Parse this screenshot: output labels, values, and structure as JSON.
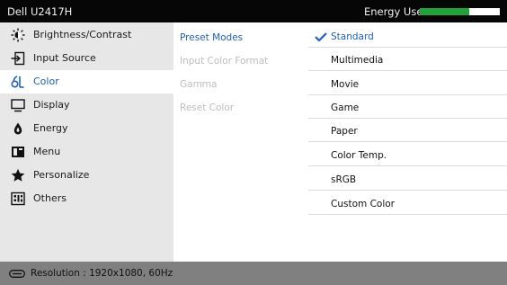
{
  "header": {
    "model": "Dell U2417H",
    "energy_label": "Energy Use",
    "energy_level": 0.62
  },
  "menu": {
    "items": [
      {
        "label": "Brightness/Contrast",
        "icon": "brightness-icon"
      },
      {
        "label": "Input Source",
        "icon": "input-source-icon"
      },
      {
        "label": "Color",
        "icon": "color-icon",
        "selected": true
      },
      {
        "label": "Display",
        "icon": "display-icon"
      },
      {
        "label": "Energy",
        "icon": "energy-icon"
      },
      {
        "label": "Menu",
        "icon": "menu-icon"
      },
      {
        "label": "Personalize",
        "icon": "star-icon"
      },
      {
        "label": "Others",
        "icon": "others-icon"
      }
    ]
  },
  "submenu": {
    "items": [
      {
        "label": "Preset Modes",
        "active": true
      },
      {
        "label": "Input Color Format"
      },
      {
        "label": "Gamma"
      },
      {
        "label": "Reset Color"
      }
    ]
  },
  "options": {
    "items": [
      {
        "label": "Standard",
        "selected": true
      },
      {
        "label": "Multimedia"
      },
      {
        "label": "Movie"
      },
      {
        "label": "Game"
      },
      {
        "label": "Paper"
      },
      {
        "label": "Color Temp."
      },
      {
        "label": "sRGB"
      },
      {
        "label": "Custom Color"
      }
    ]
  },
  "footer": {
    "resolution": "Resolution : 1920x1080, 60Hz"
  },
  "colors": {
    "accent": "#1f5fbf",
    "energy_fill": "#22a33a"
  }
}
